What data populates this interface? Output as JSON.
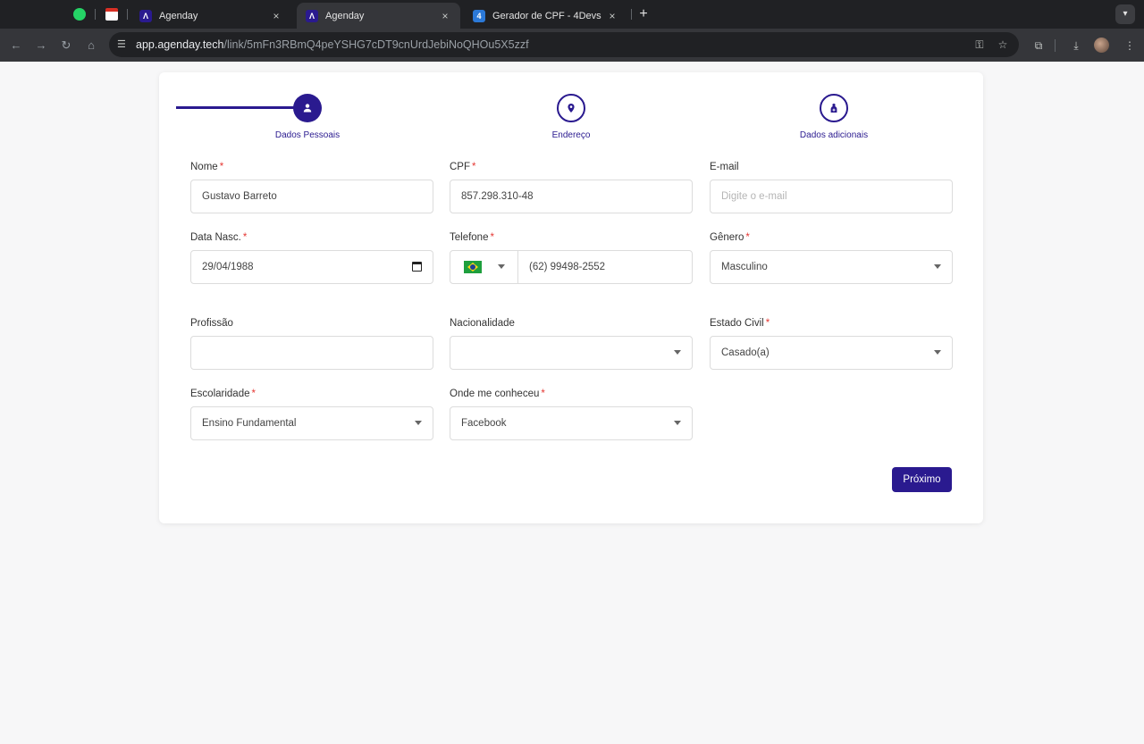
{
  "browser": {
    "tabs": [
      {
        "title": "Agenday",
        "close": "×"
      },
      {
        "title": "Agenday",
        "close": "×"
      },
      {
        "title": "Gerador de CPF - 4Devs",
        "close": "×"
      }
    ],
    "new_tab": "+",
    "url_domain": "app.agenday.tech",
    "url_path": "/link/5mFn3RBmQ4peYSHG7cDT9cnUrdJebiNoQHOu5X5zzf"
  },
  "stepper": {
    "steps": [
      {
        "label": "Dados Pessoais",
        "state": "active",
        "icon": "person-icon"
      },
      {
        "label": "Endereço",
        "state": "pending",
        "icon": "location-pin-icon"
      },
      {
        "label": "Dados adicionais",
        "state": "pending",
        "icon": "person-plus-icon"
      }
    ]
  },
  "form": {
    "nome": {
      "label": "Nome",
      "required": "*",
      "value": "Gustavo Barreto"
    },
    "cpf": {
      "label": "CPF",
      "required": "*",
      "value": "857.298.310-48"
    },
    "email": {
      "label": "E-mail",
      "placeholder": "Digite o e-mail",
      "value": ""
    },
    "data_nasc": {
      "label": "Data Nasc.",
      "required": "*",
      "value": "29/04/1988"
    },
    "telefone": {
      "label": "Telefone",
      "required": "*",
      "country": "Brasil",
      "value": "(62) 99498-2552"
    },
    "genero": {
      "label": "Gênero",
      "required": "*",
      "value": "Masculino"
    },
    "profissao": {
      "label": "Profissão",
      "value": ""
    },
    "nacionalidade": {
      "label": "Nacionalidade",
      "value": ""
    },
    "estado_civil": {
      "label": "Estado Civil",
      "required": "*",
      "value": "Casado(a)"
    },
    "escolaridade": {
      "label": "Escolaridade",
      "required": "*",
      "value": "Ensino Fundamental"
    },
    "onde_conheceu": {
      "label": "Onde me conheceu",
      "required": "*",
      "value": "Facebook"
    }
  },
  "actions": {
    "next_label": "Próximo"
  },
  "colors": {
    "primary": "#2a1a8f",
    "required": "#e53935",
    "border": "#dcdcdc"
  }
}
